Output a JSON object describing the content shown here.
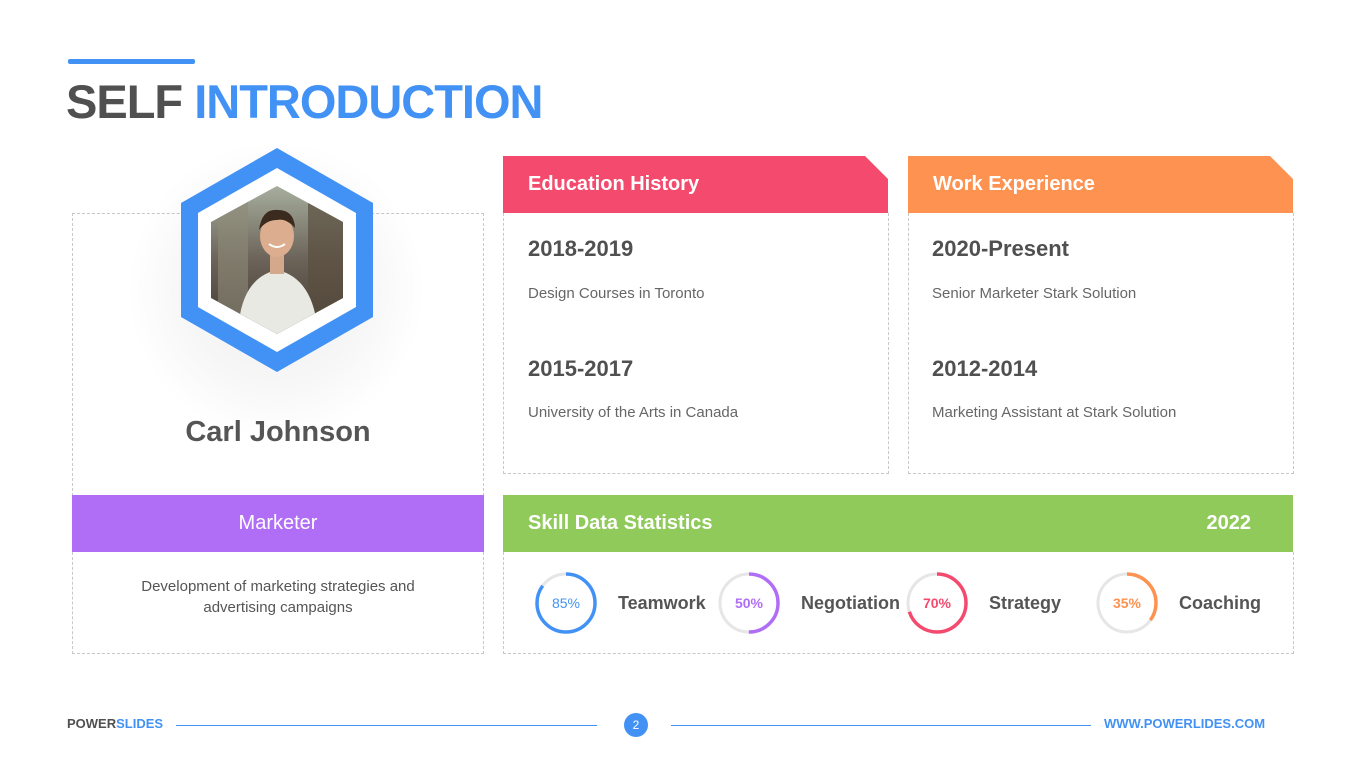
{
  "title": {
    "part1": "SELF",
    "part2": "INTRODUCTION"
  },
  "profile": {
    "name": "Carl Johnson",
    "role": "Marketer",
    "description_line1": "Development of marketing strategies and",
    "description_line2": "advertising campaigns"
  },
  "education": {
    "header": "Education History",
    "entries": [
      {
        "year": "2018-2019",
        "text": "Design Courses in Toronto"
      },
      {
        "year": "2015-2017",
        "text": "University of the Arts in Canada"
      }
    ]
  },
  "work": {
    "header": "Work Experience",
    "entries": [
      {
        "year": "2020-Present",
        "text": "Senior Marketer Stark Solution"
      },
      {
        "year": "2012-2014",
        "text": "Marketing Assistant at Stark Solution"
      }
    ]
  },
  "skills": {
    "header": "Skill Data Statistics",
    "year": "2022",
    "items": [
      {
        "label": "Teamwork",
        "percent_text": "85%",
        "value": 85,
        "color": "#4292f5"
      },
      {
        "label": "Negotiation",
        "percent_text": "50%",
        "value": 50,
        "color": "#b06ef6"
      },
      {
        "label": "Strategy",
        "percent_text": "70%",
        "value": 70,
        "color": "#f44a6e"
      },
      {
        "label": "Coaching",
        "percent_text": "35%",
        "value": 35,
        "color": "#fd9251"
      }
    ]
  },
  "footer": {
    "brand_part1": "POWER",
    "brand_part2": "SLIDES",
    "page": "2",
    "url": "WWW.POWERLIDES.COM"
  },
  "colors": {
    "blue": "#4292f5",
    "pink": "#f44a6e",
    "orange": "#fd9251",
    "purple": "#b06ef6",
    "green": "#8fca5a"
  }
}
